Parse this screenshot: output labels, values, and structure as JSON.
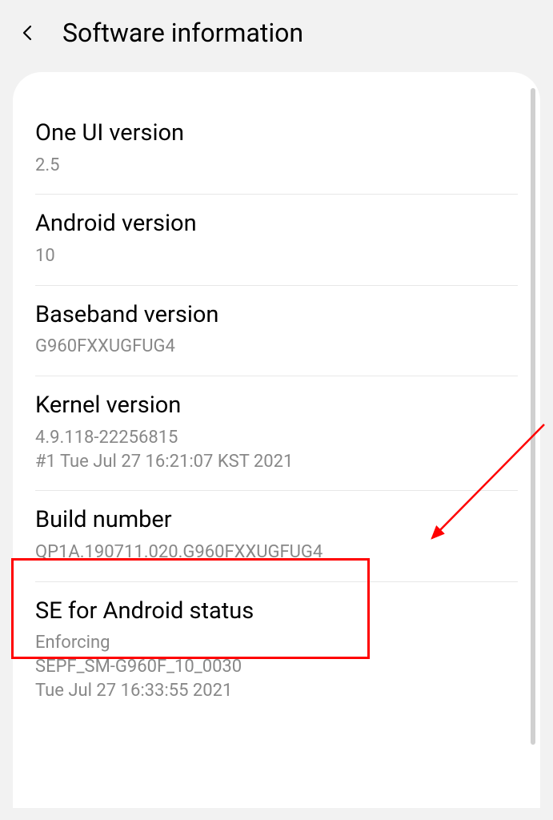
{
  "header": {
    "title": "Software information"
  },
  "items": [
    {
      "title": "One UI version",
      "value": "2.5"
    },
    {
      "title": "Android version",
      "value": "10"
    },
    {
      "title": "Baseband version",
      "value": "G960FXXUGFUG4"
    },
    {
      "title": "Kernel version",
      "value": "4.9.118-22256815\n#1 Tue Jul 27 16:21:07 KST 2021"
    },
    {
      "title": "Build number",
      "value": "QP1A.190711.020.G960FXXUGFUG4"
    },
    {
      "title": "SE for Android status",
      "value": "Enforcing\nSEPF_SM-G960F_10_0030\nTue Jul 27 16:33:55 2021"
    }
  ],
  "annotation": {
    "highlight_color": "#ff0000"
  }
}
